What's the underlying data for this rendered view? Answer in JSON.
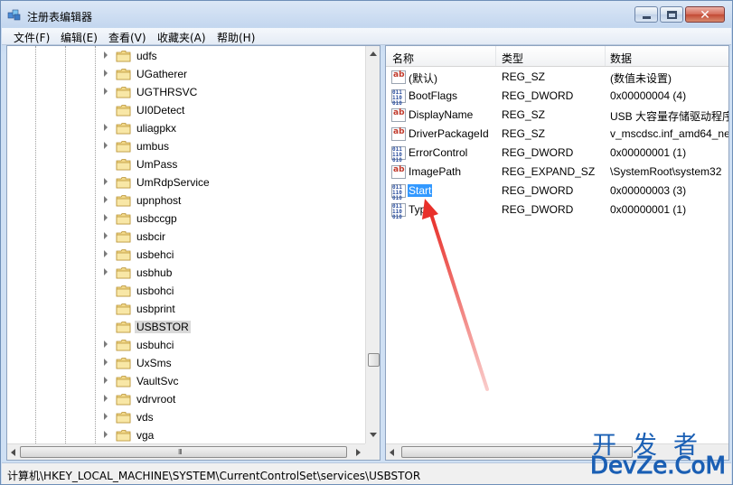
{
  "window": {
    "title": "注册表编辑器",
    "minimize_icon": "minimize-icon",
    "maximize_icon": "maximize-icon",
    "close_icon": "close-icon"
  },
  "menu": [
    "文件(F)",
    "编辑(E)",
    "查看(V)",
    "收藏夹(A)",
    "帮助(H)"
  ],
  "tree": {
    "items": [
      {
        "label": "udfs",
        "expandable": true
      },
      {
        "label": "UGatherer",
        "expandable": true
      },
      {
        "label": "UGTHRSVC",
        "expandable": true
      },
      {
        "label": "UI0Detect",
        "expandable": false
      },
      {
        "label": "uliagpkx",
        "expandable": true
      },
      {
        "label": "umbus",
        "expandable": true
      },
      {
        "label": "UmPass",
        "expandable": false
      },
      {
        "label": "UmRdpService",
        "expandable": true
      },
      {
        "label": "upnphost",
        "expandable": true
      },
      {
        "label": "usbccgp",
        "expandable": true
      },
      {
        "label": "usbcir",
        "expandable": true
      },
      {
        "label": "usbehci",
        "expandable": true
      },
      {
        "label": "usbhub",
        "expandable": true
      },
      {
        "label": "usbohci",
        "expandable": false
      },
      {
        "label": "usbprint",
        "expandable": false
      },
      {
        "label": "USBSTOR",
        "expandable": false,
        "selected": true
      },
      {
        "label": "usbuhci",
        "expandable": true
      },
      {
        "label": "UxSms",
        "expandable": true
      },
      {
        "label": "VaultSvc",
        "expandable": true
      },
      {
        "label": "vdrvroot",
        "expandable": true
      },
      {
        "label": "vds",
        "expandable": true
      },
      {
        "label": "vga",
        "expandable": true
      }
    ],
    "hscroll_grip": "III"
  },
  "list": {
    "columns": {
      "name": "名称",
      "type": "类型",
      "data": "数据"
    },
    "rows": [
      {
        "name": "(默认)",
        "type": "REG_SZ",
        "data": "(数值未设置)",
        "icon": "string"
      },
      {
        "name": "BootFlags",
        "type": "REG_DWORD",
        "data": "0x00000004 (4)",
        "icon": "binary"
      },
      {
        "name": "DisplayName",
        "type": "REG_SZ",
        "data": "USB 大容量存储驱动程序",
        "icon": "string"
      },
      {
        "name": "DriverPackageId",
        "type": "REG_SZ",
        "data": "v_mscdsc.inf_amd64_ne",
        "icon": "string"
      },
      {
        "name": "ErrorControl",
        "type": "REG_DWORD",
        "data": "0x00000001 (1)",
        "icon": "binary"
      },
      {
        "name": "ImagePath",
        "type": "REG_EXPAND_SZ",
        "data": "\\SystemRoot\\system32",
        "icon": "string"
      },
      {
        "name": "Start",
        "type": "REG_DWORD",
        "data": "0x00000003 (3)",
        "icon": "binary",
        "selected": true
      },
      {
        "name": "Type",
        "type": "REG_DWORD",
        "data": "0x00000001 (1)",
        "icon": "binary"
      }
    ]
  },
  "status": {
    "path": "计算机\\HKEY_LOCAL_MACHINE\\SYSTEM\\CurrentControlSet\\services\\USBSTOR"
  },
  "watermark": {
    "top": "开发者",
    "bottom": "DevZe.CoM"
  },
  "colors": {
    "selection": "#3399ff",
    "annotation_arrow": "#e8302a",
    "watermark": "#1a5fb4"
  }
}
